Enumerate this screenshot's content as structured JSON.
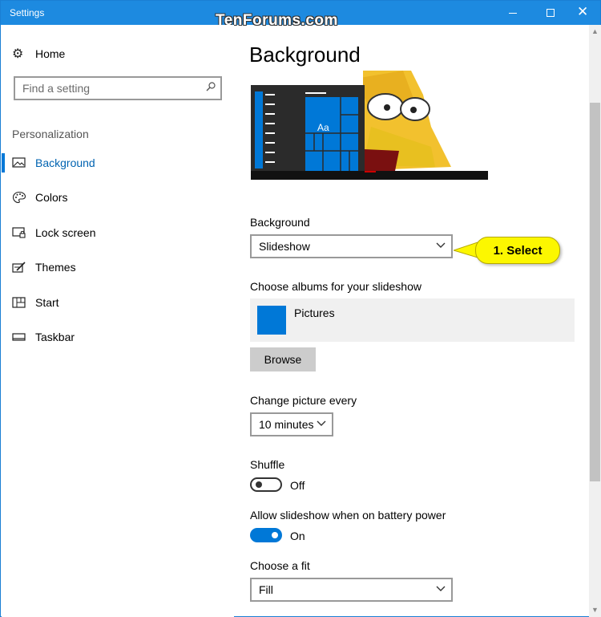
{
  "window": {
    "title": "Settings",
    "watermark": "TenForums.com",
    "controls": {
      "minimize": "minimize",
      "maximize": "maximize",
      "close": "✕"
    }
  },
  "sidebar": {
    "home_label": "Home",
    "search": {
      "placeholder": "Find a setting"
    },
    "section_title": "Personalization",
    "items": [
      {
        "label": "Background",
        "icon": "picture-icon",
        "active": true
      },
      {
        "label": "Colors",
        "icon": "palette-icon",
        "active": false
      },
      {
        "label": "Lock screen",
        "icon": "lock-screen-icon",
        "active": false
      },
      {
        "label": "Themes",
        "icon": "themes-icon",
        "active": false
      },
      {
        "label": "Start",
        "icon": "start-icon",
        "active": false
      },
      {
        "label": "Taskbar",
        "icon": "taskbar-icon",
        "active": false
      }
    ]
  },
  "content": {
    "title": "Background",
    "preview": {
      "tile_text": "Aa"
    },
    "background_label": "Background",
    "background_value": "Slideshow",
    "albums_label": "Choose albums for your slideshow",
    "album_name": "Pictures",
    "browse_label": "Browse",
    "change_every_label": "Change picture every",
    "change_every_value": "10 minutes",
    "shuffle_label": "Shuffle",
    "shuffle_state": "Off",
    "battery_label": "Allow slideshow when on battery power",
    "battery_state": "On",
    "fit_label": "Choose a fit",
    "fit_value": "Fill"
  },
  "callout": {
    "text": "1. Select"
  },
  "colors": {
    "accent": "#0078d7",
    "titlebar": "#1d8ae0",
    "callout": "#fcf700"
  }
}
